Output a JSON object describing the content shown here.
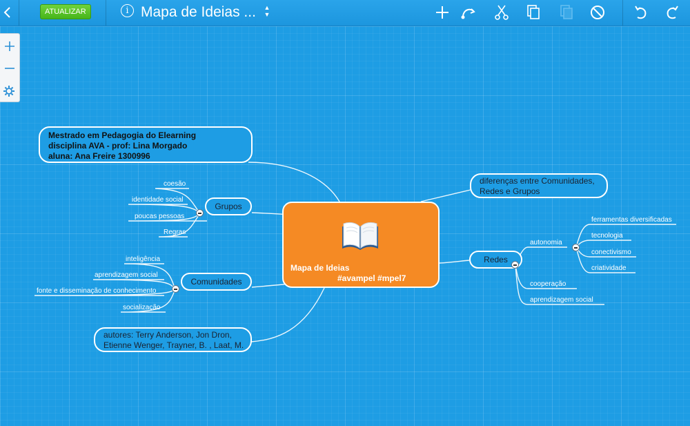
{
  "toolbar": {
    "update_label": "ATUALIZAR",
    "title": "Mapa de Ideias ...",
    "info_icon": "info-icon",
    "icons": [
      "back-icon",
      "add-icon",
      "connect-icon",
      "cut-icon",
      "copy-icon",
      "paste-icon",
      "delete-icon",
      "undo-icon",
      "redo-icon"
    ]
  },
  "zoom": {
    "icons": [
      "zoom-in-icon",
      "zoom-out-icon",
      "settings-icon"
    ]
  },
  "colors": {
    "background": "#1e9de4",
    "central": "#f58a24",
    "update_button": "#47b51a",
    "line": "#ffffff"
  },
  "map": {
    "central": {
      "line1": "Mapa de Ideias",
      "line2": "#avampel #mpel7",
      "icon": "book-icon"
    },
    "info_node": {
      "lines": [
        "Mestrado em Pedagogia do Elearning",
        "disciplina AVA - prof: Lina Morgado",
        "aluna: Ana Freire 1300996"
      ]
    },
    "grupos": {
      "label": "Grupos",
      "leaves": [
        "coesão",
        "identidade social",
        "poucas pessoas",
        "Regras"
      ]
    },
    "comunidades": {
      "label": "Comunidades",
      "leaves": [
        "inteligência",
        "aprendizagem social",
        "fonte e disseminação de conhecimento",
        "socialização"
      ]
    },
    "autores": {
      "lines": [
        "autores: Terry Anderson, Jon Dron,",
        "Etienne Wenger, Trayner, B. , Laat, M."
      ]
    },
    "diferencas": {
      "lines": [
        "diferenças entre Comunidades,",
        "Redes e Grupos"
      ]
    },
    "redes": {
      "label": "Redes",
      "autonomia": {
        "label": "autonomia",
        "leaves": [
          "ferramentas diversificadas",
          "tecnologia",
          "conectivismo",
          "criatividade"
        ]
      },
      "leaves": [
        "cooperação",
        "aprendizagem social"
      ]
    }
  }
}
